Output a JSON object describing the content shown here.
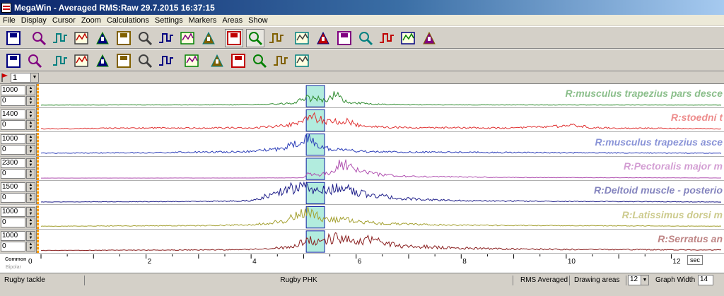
{
  "window": {
    "title": "MegaWin - Averaged RMS:Raw 29.7.2015 16:37:15"
  },
  "menu": [
    "File",
    "Display",
    "Cursor",
    "Zoom",
    "Calculations",
    "Settings",
    "Markers",
    "Areas",
    "Show"
  ],
  "toolbar1": [
    "save-icon",
    "zoom-rms-icon",
    "zoom-freq-icon",
    "magnifier-icon",
    "zoom-box-icon",
    "zoom-fit-icon",
    "cursor-left-icon",
    "cursor-right-icon",
    "step-signal-icon",
    "marker-flag-icon",
    "display-mode-icon",
    "area-select-icon",
    "scale-icon",
    "waveform-edit-icon",
    "channel-grid-icon",
    "report-icon",
    "step-pulse-icon",
    "camera-icon",
    "document-icon",
    "export-file-icon"
  ],
  "toolbar2": [
    "channels-list-icon",
    "emg-pen-icon",
    "filter-icon",
    "wave-cursor-icon",
    "pulse-icon",
    "cross-wave-icon",
    "tool-stack-icon",
    "bar-histogram-icon",
    "joint-angle-icon",
    "normalize-icon",
    "trigger-arrow-icon",
    "move-signal-icon",
    "ruler-icon",
    "frequency-bars-icon"
  ],
  "marker": {
    "selected": "1"
  },
  "channels": [
    {
      "max": "1000",
      "min": "0",
      "label": "R:musculus trapezius pars desce",
      "color": "#2e8b2e"
    },
    {
      "max": "1400",
      "min": "0",
      "label": "R:stoední t",
      "color": "#e03030"
    },
    {
      "max": "1000",
      "min": "0",
      "label": "R:musculus trapezius asce",
      "color": "#2a3cb8"
    },
    {
      "max": "2300",
      "min": "0",
      "label": "R:Pectoralis major m",
      "color": "#b050b0"
    },
    {
      "max": "1500",
      "min": "0",
      "label": "R:Deltoid muscle - posterio",
      "color": "#20208a"
    },
    {
      "max": "1000",
      "min": "0",
      "label": "R:Latissimus dorsi m",
      "color": "#a4a030"
    },
    {
      "max": "1000",
      "min": "0",
      "label": "R:Serratus an",
      "color": "#8a2020"
    }
  ],
  "axis": {
    "common_label": "Common",
    "bipolar_label": "Bipolar",
    "ticks": [
      "0",
      "2",
      "4",
      "6",
      "8",
      "10",
      "12"
    ],
    "unit": "sec",
    "xmax": 12.95
  },
  "highlight": {
    "start": 5.05,
    "end": 5.4
  },
  "chart_data": {
    "type": "line",
    "title": "",
    "xlabel": "sec",
    "ylabel": "",
    "xlim": [
      0,
      12.95
    ],
    "series": [
      {
        "name": "R:musculus trapezius pars desce",
        "x": [
          0,
          2,
          4,
          4.8,
          5.05,
          5.15,
          5.3,
          5.45,
          5.6,
          5.75,
          6,
          6.5,
          7,
          8,
          10,
          12.95
        ],
        "values": [
          20,
          25,
          40,
          110,
          420,
          320,
          380,
          160,
          720,
          230,
          120,
          60,
          40,
          30,
          25,
          20
        ]
      },
      {
        "name": "R:stoední t",
        "x": [
          0,
          1,
          2,
          3,
          4,
          4.5,
          4.9,
          5.1,
          5.3,
          5.5,
          5.8,
          6.1,
          6.5,
          7,
          9,
          10.2,
          10.5,
          11,
          12,
          12.95
        ],
        "values": [
          60,
          90,
          120,
          110,
          150,
          220,
          450,
          1000,
          800,
          500,
          620,
          300,
          180,
          150,
          120,
          300,
          140,
          110,
          90,
          60
        ]
      },
      {
        "name": "R:musculus trapezius asce",
        "x": [
          0,
          2,
          3,
          4,
          4.6,
          4.9,
          5.1,
          5.3,
          5.5,
          5.8,
          6.2,
          7,
          9,
          10.5,
          12.95
        ],
        "values": [
          40,
          60,
          90,
          120,
          280,
          650,
          750,
          380,
          240,
          180,
          120,
          90,
          70,
          55,
          40
        ]
      },
      {
        "name": "R:Pectoralis major m",
        "x": [
          0,
          4,
          5,
          5.1,
          5.3,
          5.5,
          5.7,
          6,
          6.3,
          7,
          9,
          10.5,
          12.95
        ],
        "values": [
          10,
          20,
          40,
          600,
          300,
          700,
          1800,
          900,
          500,
          200,
          80,
          60,
          20
        ]
      },
      {
        "name": "R:Deltoid muscle - posterio",
        "x": [
          0,
          3,
          4,
          4.4,
          4.8,
          5.1,
          5.3,
          5.5,
          5.7,
          6,
          6.4,
          7,
          8,
          12.95
        ],
        "values": [
          30,
          70,
          120,
          600,
          1100,
          1300,
          900,
          1000,
          1200,
          700,
          500,
          250,
          120,
          30
        ]
      },
      {
        "name": "R:Latissimus dorsi m",
        "x": [
          0,
          3,
          4,
          4.6,
          4.9,
          5.1,
          5.3,
          5.6,
          6,
          6.5,
          7.5,
          9,
          12.95
        ],
        "values": [
          20,
          50,
          90,
          250,
          600,
          750,
          450,
          380,
          280,
          150,
          90,
          60,
          20
        ]
      },
      {
        "name": "R:Serratus an",
        "x": [
          0,
          3,
          4,
          4.8,
          5.1,
          5.3,
          5.6,
          6,
          6.2,
          6.8,
          8,
          9,
          12.95
        ],
        "values": [
          20,
          45,
          70,
          180,
          620,
          400,
          700,
          450,
          600,
          250,
          130,
          90,
          40
        ]
      }
    ]
  },
  "status": {
    "left": "Rugby tackle",
    "center": "Rugby PHK",
    "rms": "RMS Averaged",
    "drawing_label": "Drawing areas",
    "drawing_value": "12",
    "graph_label": "Graph Width",
    "graph_value": "14"
  }
}
